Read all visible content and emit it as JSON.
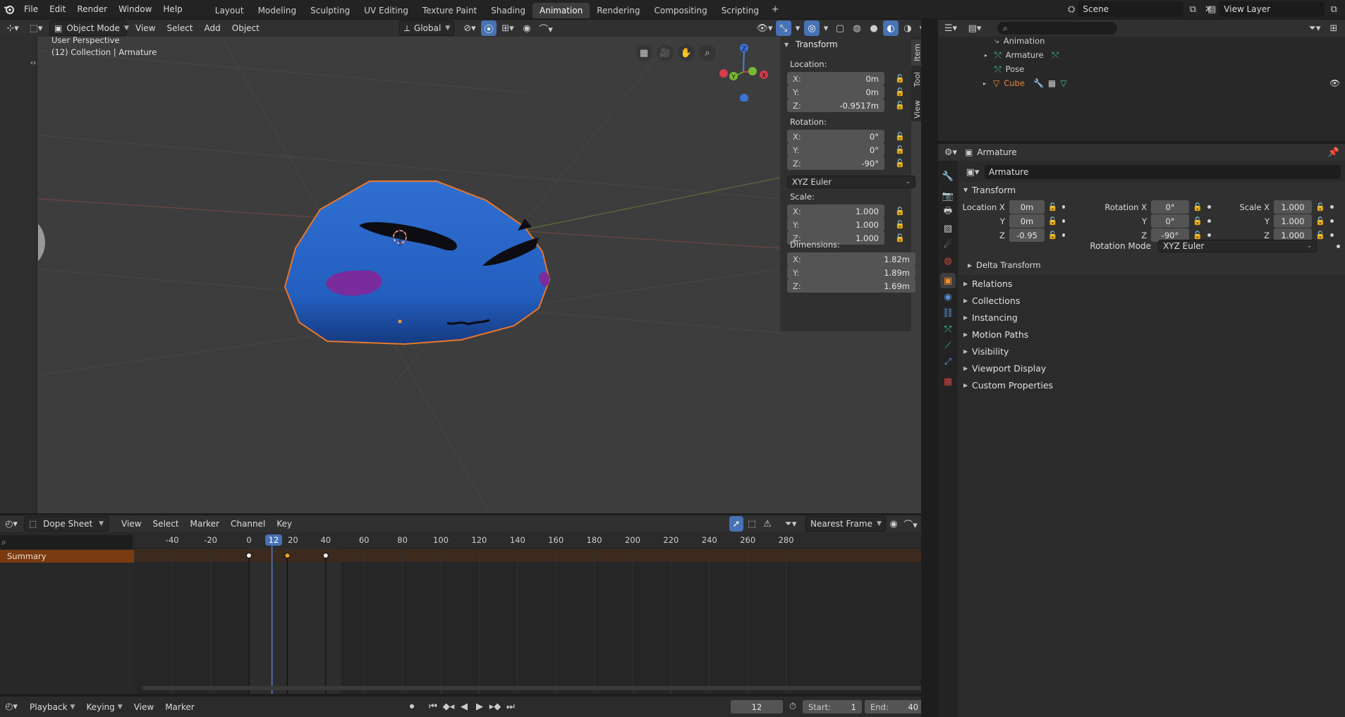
{
  "topbar": {
    "menus": [
      "File",
      "Edit",
      "Render",
      "Window",
      "Help"
    ],
    "workspaces": [
      "Layout",
      "Modeling",
      "Sculpting",
      "UV Editing",
      "Texture Paint",
      "Shading",
      "Animation",
      "Rendering",
      "Compositing",
      "Scripting"
    ],
    "active_workspace": "Animation",
    "add_tab": "+",
    "scene_label": "Scene",
    "view_layer_label": "View Layer"
  },
  "viewport": {
    "mode": "Object Mode",
    "menus": [
      "View",
      "Select",
      "Add",
      "Object"
    ],
    "orientation": "Global",
    "perspective_label": "User Perspective",
    "collection_label": "(12) Collection | Armature",
    "gizmo_axes": [
      "Z",
      "Y",
      "X"
    ]
  },
  "n_panel": {
    "header": "Transform",
    "location_label": "Location:",
    "location": {
      "x": "0m",
      "y": "0m",
      "z": "-0.9517m"
    },
    "rotation_label": "Rotation:",
    "rotation": {
      "x": "0°",
      "y": "0°",
      "z": "-90°"
    },
    "rotation_mode": "XYZ Euler",
    "scale_label": "Scale:",
    "scale": {
      "x": "1.000",
      "y": "1.000",
      "z": "1.000"
    },
    "dimensions_label": "Dimensions:",
    "dimensions": {
      "x": "1.82m",
      "y": "1.89m",
      "z": "1.69m"
    },
    "axis_labels": {
      "x": "X:",
      "y": "Y:",
      "z": "Z:"
    },
    "vtabs": [
      "Item",
      "Tool",
      "View"
    ]
  },
  "outliner": {
    "items": [
      {
        "label": "Animation",
        "color": "#cfcfcf"
      },
      {
        "label": "Armature",
        "color": "#cfcfcf"
      },
      {
        "label": "Pose",
        "color": "#cfcfcf"
      },
      {
        "label": "Cube",
        "color": "#e8843c"
      }
    ]
  },
  "properties": {
    "object_label": "Armature",
    "name_field": "Armature",
    "transform_header": "Transform",
    "location_x_label": "Location X",
    "rotation_x_label": "Rotation X",
    "scale_x_label": "Scale X",
    "y_label": "Y",
    "z_label": "Z",
    "location": {
      "x": "0m",
      "y": "0m",
      "z": "-0.95"
    },
    "rotation": {
      "x": "0°",
      "y": "0°",
      "z": "-90°"
    },
    "scale": {
      "x": "1.000",
      "y": "1.000",
      "z": "1.000"
    },
    "rotation_mode_label": "Rotation Mode",
    "rotation_mode_value": "XYZ Euler",
    "delta_transform": "Delta Transform",
    "sections": [
      "Relations",
      "Collections",
      "Instancing",
      "Motion Paths",
      "Visibility",
      "Viewport Display",
      "Custom Properties"
    ]
  },
  "dopesheet": {
    "editor_mode": "Dope Sheet",
    "menus": [
      "View",
      "Select",
      "Marker",
      "Channel",
      "Key"
    ],
    "snap_mode": "Nearest Frame",
    "summary_label": "Summary",
    "ruler_numbers": [
      "-40",
      "-20",
      "0",
      "20",
      "40",
      "60",
      "80",
      "100",
      "120",
      "140",
      "160",
      "180",
      "200",
      "220",
      "240",
      "260",
      "280"
    ],
    "current_frame": "12",
    "keyframes": [
      0,
      20,
      40
    ]
  },
  "playback": {
    "menus": [
      "Playback",
      "Keying",
      "View",
      "Marker"
    ],
    "current_frame": "12",
    "start_label": "Start:",
    "start_value": "1",
    "end_label": "End:",
    "end_value": "40"
  }
}
